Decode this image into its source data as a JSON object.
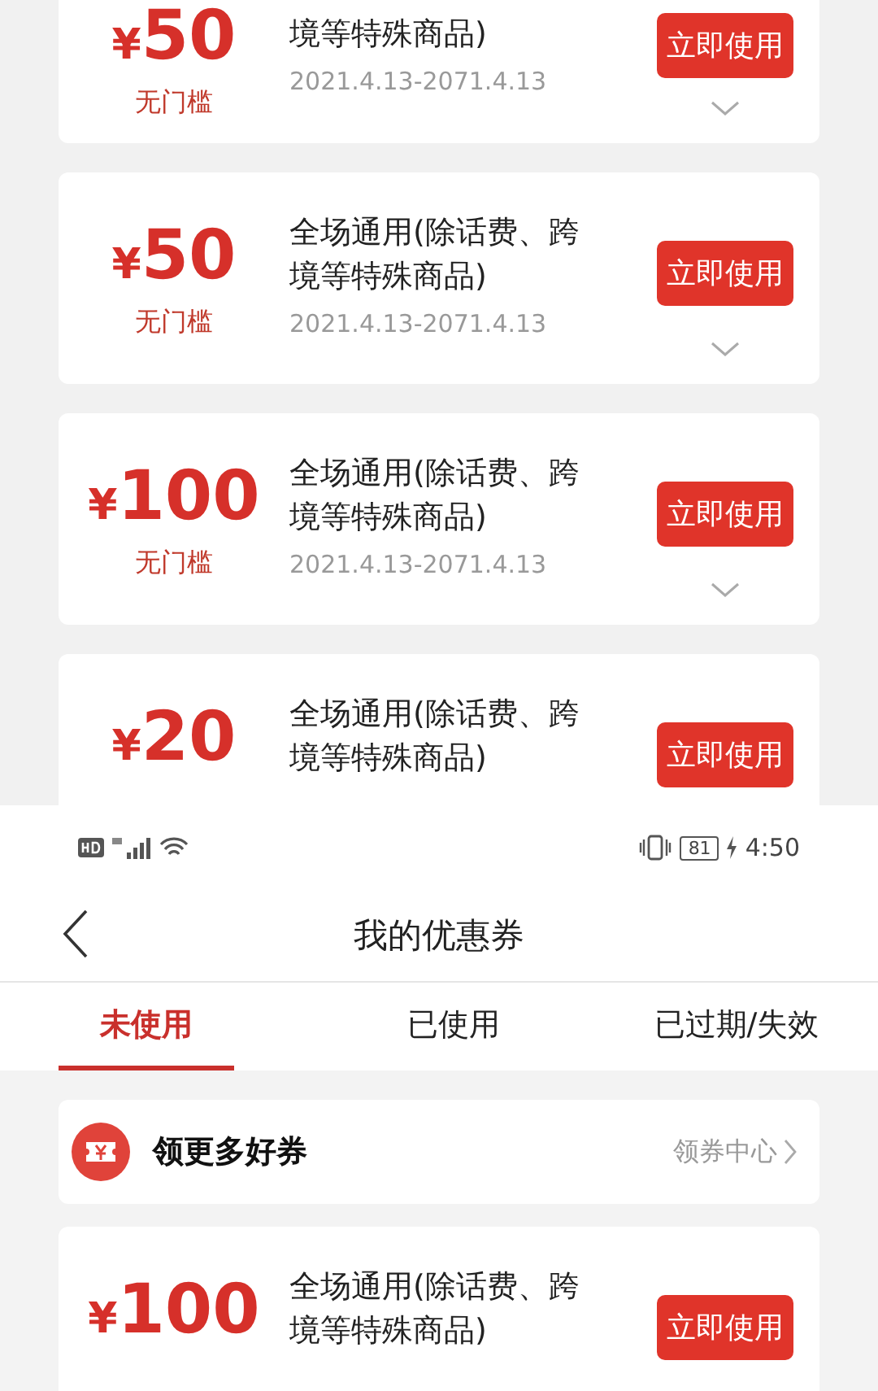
{
  "top_screen": {
    "coupons": [
      {
        "currency": "¥",
        "amount": "50",
        "condition": "无门槛",
        "title_lines": [
          "境等特殊商品)"
        ],
        "validity": "2021.4.13-2071.4.13",
        "button": "立即使用"
      },
      {
        "currency": "¥",
        "amount": "50",
        "condition": "无门槛",
        "title_lines": [
          "全场通用(除话费、跨",
          "境等特殊商品)"
        ],
        "validity": "2021.4.13-2071.4.13",
        "button": "立即使用"
      },
      {
        "currency": "¥",
        "amount": "100",
        "condition": "无门槛",
        "title_lines": [
          "全场通用(除话费、跨",
          "境等特殊商品)"
        ],
        "validity": "2021.4.13-2071.4.13",
        "button": "立即使用"
      },
      {
        "currency": "¥",
        "amount": "20",
        "title_lines": [
          "全场通用(除话费、跨",
          "境等特殊商品)"
        ],
        "button": "立即使用"
      }
    ]
  },
  "status_bar": {
    "battery": "81",
    "time": "4:50"
  },
  "nav": {
    "title": "我的优惠券"
  },
  "tabs": [
    {
      "label": "未使用",
      "selected": true
    },
    {
      "label": "已使用",
      "selected": false
    },
    {
      "label": "已过期/失效",
      "selected": false
    }
  ],
  "banner": {
    "title": "领更多好券",
    "link": "领券中心"
  },
  "coupons": [
    {
      "currency": "¥",
      "amount": "100",
      "title_lines": [
        "全场通用(除话费、跨",
        "境等特殊商品)"
      ],
      "button": "立即使用"
    }
  ]
}
